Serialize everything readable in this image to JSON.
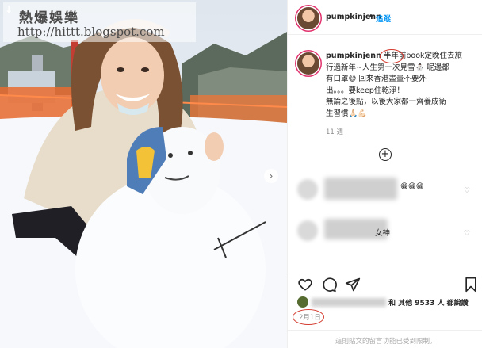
{
  "watermark": {
    "title": "熱爆娛樂",
    "url": "http://hittt.blogspot.com"
  },
  "post": {
    "username": "pumpkinjenn",
    "follow_label": "追蹤",
    "separator": "•",
    "caption_highlight": "半年",
    "caption_lines": [
      "前book定晚住去旅",
      "行過新年~人生第一次見雪⛄ 呢邊都",
      "有口罩😅 回來香港盡量不要外",
      "出。。。要keep住乾淨！",
      "無論之後點，以後大家都一齊養成衛",
      "生習慣🙏🏻💪🏻"
    ],
    "caption_time": "11 週",
    "date": "2月1日",
    "likes_text": "和 其他 9533 人 都說讚"
  },
  "comments": [
    {
      "emoji": "😁😁😁",
      "text": ""
    },
    {
      "emoji": "",
      "text": "女神"
    }
  ],
  "icons": {
    "next": "chevron-right-icon",
    "like": "heart-icon",
    "comment": "comment-icon",
    "share": "paper-plane-icon",
    "save": "bookmark-icon",
    "load_more": "plus-circle-icon"
  },
  "footer": {
    "notice": "這則貼文的留言功能已受到限制。"
  },
  "colors": {
    "accent": "#0095f6",
    "annotation": "#d43b2f"
  }
}
